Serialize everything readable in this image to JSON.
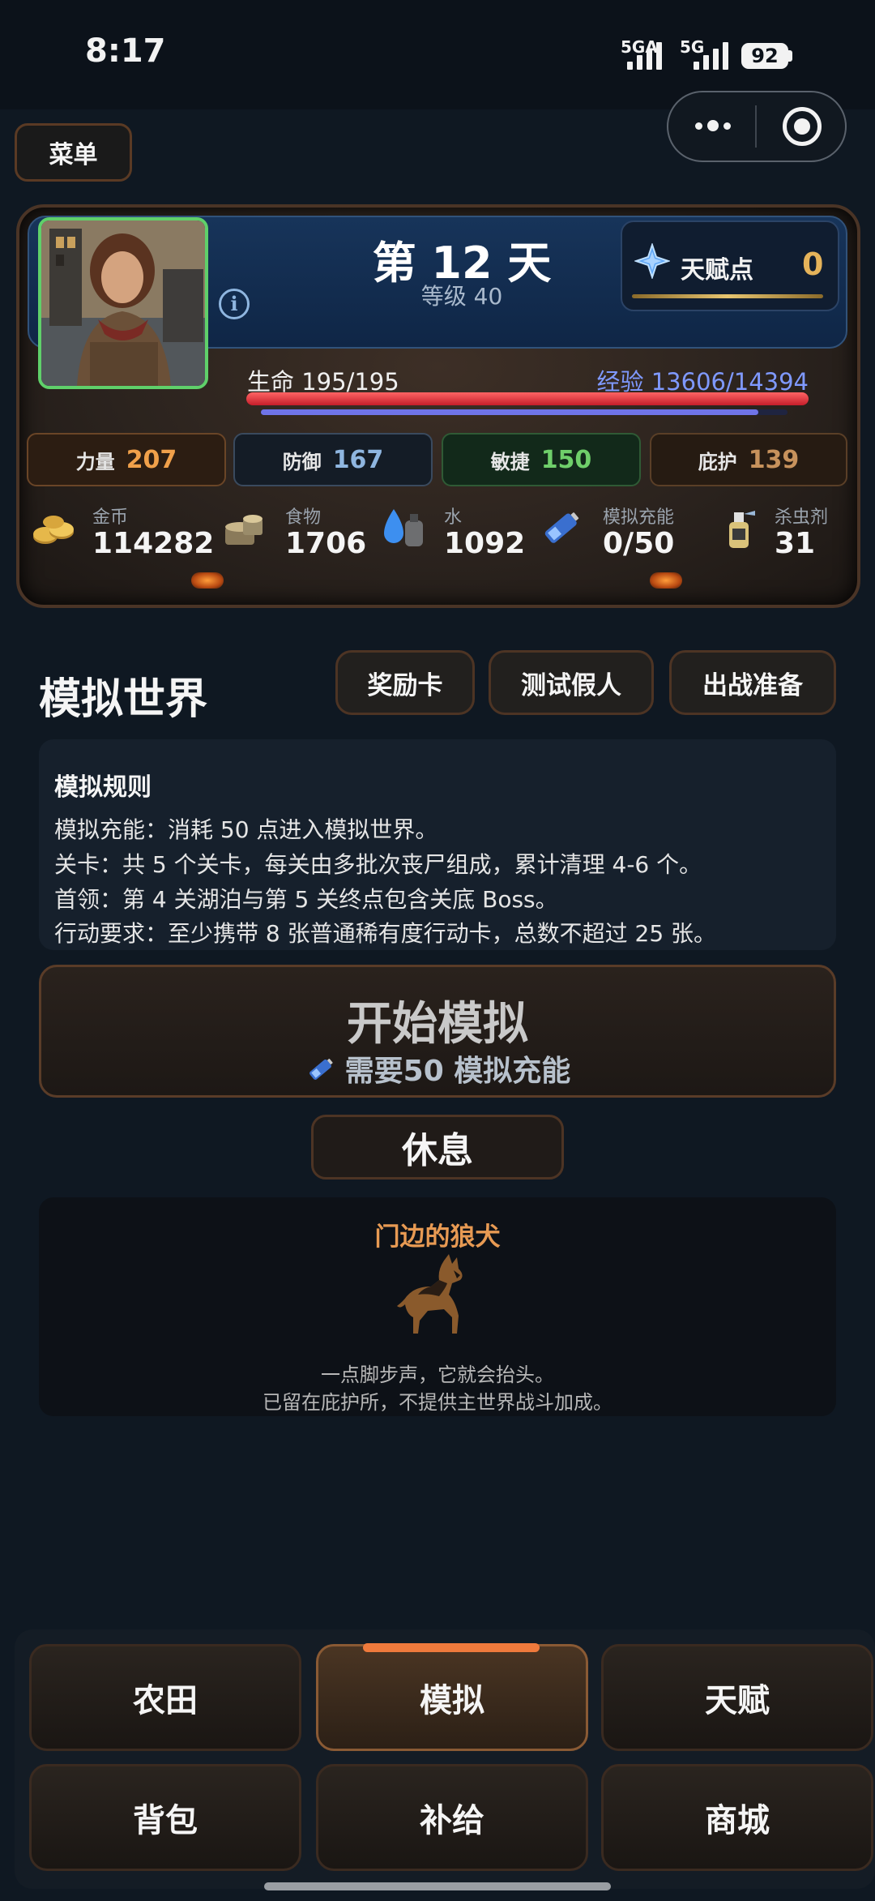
{
  "status_bar": {
    "time": "8:17",
    "network_1": "5GA",
    "network_2": "5G",
    "battery": "92"
  },
  "menu": {
    "label": "菜单"
  },
  "character": {
    "day": "第 12 天",
    "level": "等级 40",
    "info_icon": "i",
    "talent_label": "天赋点",
    "talent_value": "0",
    "hp_text": "生命 195/195",
    "hp_ratio": 1.0,
    "xp_text": "经验 13606/14394",
    "xp_ratio": 0.945,
    "stats": [
      {
        "label": "力量",
        "value": "207",
        "color": "#f0a04a"
      },
      {
        "label": "防御",
        "value": "167",
        "color": "#8fb6e0"
      },
      {
        "label": "敏捷",
        "value": "150",
        "color": "#6fcf6a"
      },
      {
        "label": "庇护",
        "value": "139",
        "color": "#c7925c"
      }
    ],
    "resources": [
      {
        "label": "金币",
        "value": "114282",
        "icon": "gold-coins-icon"
      },
      {
        "label": "食物",
        "value": "1706",
        "icon": "food-icon"
      },
      {
        "label": "水",
        "value": "1092",
        "icon": "water-icon"
      },
      {
        "label": "模拟充能",
        "value": "0/50",
        "icon": "battery-icon"
      },
      {
        "label": "杀虫剂",
        "value": "31",
        "icon": "spray-icon"
      }
    ]
  },
  "section": {
    "title": "模拟世界",
    "buttons": [
      "奖励卡",
      "测试假人",
      "出战准备"
    ]
  },
  "rules": {
    "title": "模拟规则",
    "lines": [
      "模拟充能：消耗 50 点进入模拟世界。",
      "关卡：共 5 个关卡，每关由多批次丧尸组成，累计清理 4-6 个。",
      "首领：第 4 关湖泊与第 5 关终点包含关底 Boss。",
      "行动要求：至少携带 8 张普通稀有度行动卡，总数不超过 25 张。"
    ]
  },
  "start": {
    "label": "开始模拟",
    "requirement": "需要50 模拟充能"
  },
  "rest": {
    "label": "休息"
  },
  "pet": {
    "title": "门边的狼犬",
    "line_1": "一点脚步声，它就会抬头。",
    "line_2": "已留在庇护所，不提供主世界战斗加成。"
  },
  "nav": {
    "items": [
      "农田",
      "模拟",
      "天赋",
      "背包",
      "补给",
      "商城"
    ],
    "active": "模拟"
  }
}
